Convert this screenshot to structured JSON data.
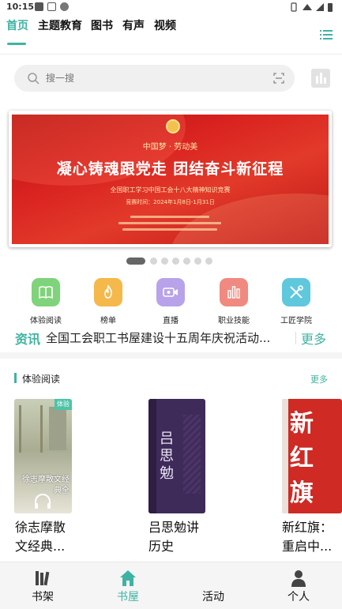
{
  "status_bar": {
    "time": "10:15"
  },
  "top_tabs": [
    {
      "label": "首页",
      "active": true
    },
    {
      "label": "主题教育",
      "active": false
    },
    {
      "label": "图书",
      "active": false
    },
    {
      "label": "有声",
      "active": false
    },
    {
      "label": "视频",
      "active": false
    }
  ],
  "search": {
    "placeholder": "搜一搜"
  },
  "banner": {
    "header": "中国梦 · 劳动美",
    "title": "凝心铸魂跟党走  团结奋斗新征程",
    "subtitle": "全国职工学习中国工会十八大精神知识竞赛",
    "line": "竞赛时间：2024年1月8日-1月31日"
  },
  "carousel": {
    "count": 8,
    "active_index": 0
  },
  "quick_links": [
    {
      "label": "体验阅读",
      "icon": "book-icon",
      "color": "#7fd37a"
    },
    {
      "label": "榜单",
      "icon": "flame-icon",
      "color": "#f5b84a"
    },
    {
      "label": "直播",
      "icon": "video-icon",
      "color": "#b8a3ea"
    },
    {
      "label": "职业技能",
      "icon": "bars-icon",
      "color": "#f08a80"
    },
    {
      "label": "工匠学院",
      "icon": "tools-icon",
      "color": "#5fc8dd"
    }
  ],
  "news": {
    "tag": "资讯",
    "text": "全国工会职工书屋建设十五周年庆祝活动...",
    "more": "更多"
  },
  "section": {
    "title": "体验阅读",
    "more": "更多"
  },
  "books": [
    {
      "title_line1": "徐志摩散",
      "title_line2": "文经典...",
      "badge": "体验",
      "cover_text": "徐志摩散文经典全"
    },
    {
      "title_line1": "吕思勉讲",
      "title_line2": "历史",
      "cover_text": "吕思勉"
    },
    {
      "title_line1": "新红旗：",
      "title_line2": "重启中...",
      "cover_text": "新红旗"
    }
  ],
  "bottom_nav": [
    {
      "label": "书架",
      "icon": "bookshelf-icon",
      "active": false
    },
    {
      "label": "书屋",
      "icon": "home-icon",
      "active": true
    },
    {
      "label": "活动",
      "icon": "activity-icon",
      "active": false
    },
    {
      "label": "个人",
      "icon": "person-icon",
      "active": false
    }
  ],
  "colors": {
    "accent": "#3fb3a3",
    "banner_red": "#d92320"
  }
}
